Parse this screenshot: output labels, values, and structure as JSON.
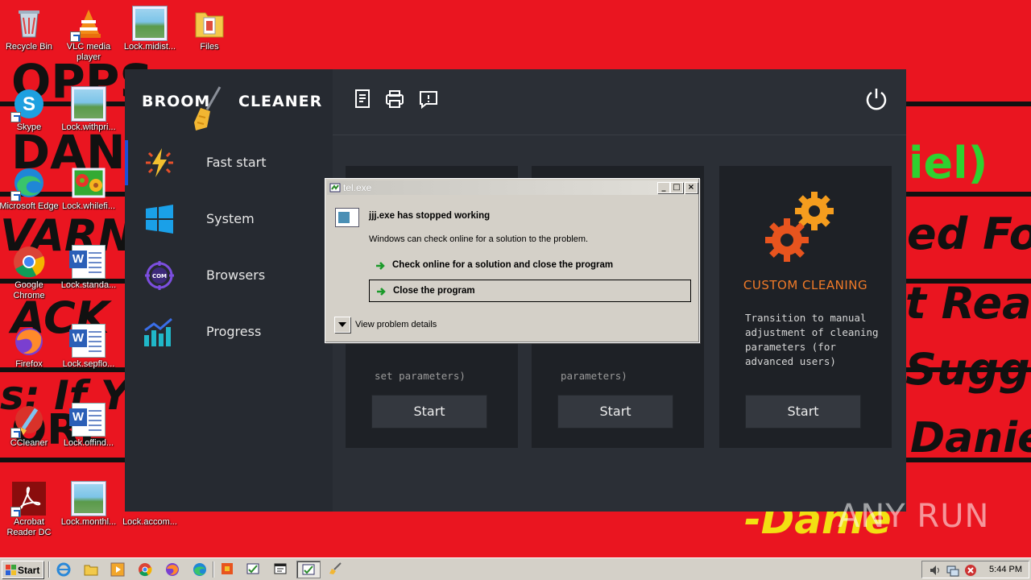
{
  "desktop": {
    "wallpaper": {
      "lines": [
        {
          "text": "OPPS",
          "style": "dark"
        },
        {
          "text": "DANI",
          "style": "dark"
        },
        {
          "text": "iel)",
          "style": "green"
        },
        {
          "text": "VARNI",
          "style": "dark"
        },
        {
          "text": "ed For",
          "style": "dark"
        },
        {
          "text": "ACK B",
          "style": "dark"
        },
        {
          "text": "t Real",
          "style": "dark"
        },
        {
          "text": "s: If Y",
          "style": "dark"
        },
        {
          "text": "Sugge",
          "style": "dark"
        },
        {
          "text": "ORE",
          "style": "dark"
        },
        {
          "text": "Daniel",
          "style": "dark"
        },
        {
          "text": "-Danie",
          "style": "yellow"
        }
      ]
    },
    "icons": [
      {
        "label": "Recycle Bin",
        "icon": "recycle-bin-icon"
      },
      {
        "label": "VLC media player",
        "icon": "vlc-icon"
      },
      {
        "label": "Lock.midist...",
        "icon": "image-file-icon"
      },
      {
        "label": "Files",
        "icon": "folder-icon"
      },
      {
        "label": "Skype",
        "icon": "skype-icon"
      },
      {
        "label": "Lock.withpri...",
        "icon": "image-file-icon"
      },
      {
        "label": "Microsoft Edge",
        "icon": "edge-icon"
      },
      {
        "label": "Lock.whilefi...",
        "icon": "image-file-icon"
      },
      {
        "label": "Google Chrome",
        "icon": "chrome-icon"
      },
      {
        "label": "Lock.standa...",
        "icon": "word-doc-icon"
      },
      {
        "label": "Firefox",
        "icon": "firefox-icon"
      },
      {
        "label": "Lock.sepflo...",
        "icon": "word-doc-icon"
      },
      {
        "label": "CCleaner",
        "icon": "ccleaner-icon"
      },
      {
        "label": "Lock.offind...",
        "icon": "word-doc-icon"
      },
      {
        "label": "Acrobat Reader DC",
        "icon": "acrobat-icon"
      },
      {
        "label": "Lock.monthl...",
        "icon": "image-file-icon"
      },
      {
        "label": "Lock.accom...",
        "icon": "image-file-icon"
      }
    ]
  },
  "app": {
    "logo_left": "BROOM",
    "logo_right": "CLEANER",
    "sidebar": [
      {
        "label": "Fast start",
        "icon": "lightning-icon",
        "active": true
      },
      {
        "label": "System",
        "icon": "windows-icon",
        "active": false
      },
      {
        "label": "Browsers",
        "icon": "browser-target-icon",
        "active": false
      },
      {
        "label": "Progress",
        "icon": "bar-chart-icon",
        "active": false
      }
    ],
    "topbar_icons": [
      "report-icon",
      "printer-icon",
      "feedback-icon",
      "power-icon"
    ],
    "cards": [
      {
        "title": "",
        "desc": "",
        "underlay": "set parameters)",
        "button": "Start"
      },
      {
        "title": "",
        "desc": "",
        "underlay": "parameters)",
        "button": "Start"
      },
      {
        "title": "CUSTOM CLEANING",
        "desc": "Transition to manual adjustment of cleaning parameters (for advanced users)",
        "underlay": "",
        "button": "Start"
      }
    ],
    "colors": {
      "accent": "#f07a28",
      "sidebar_active": "#1b4fd8",
      "background": "#2b2f36"
    }
  },
  "dialog": {
    "title": "tel.exe",
    "heading": "jjj.exe has stopped working",
    "subtext": "Windows can check online for a solution to the problem.",
    "options": [
      {
        "label": "Check online for a solution and close the program",
        "focused": false
      },
      {
        "label": "Close the program",
        "focused": true
      }
    ],
    "details_label": "View problem details",
    "buttons": {
      "minimize": "_",
      "maximize": "□",
      "close": "×"
    }
  },
  "taskbar": {
    "start_label": "Start",
    "quick_launch": [
      "ie-icon",
      "explorer-icon",
      "media-player-icon",
      "chrome-icon",
      "firefox-icon",
      "edge-icon"
    ],
    "tasks": [
      "app-task-icon",
      "check-task-icon",
      "window-task-icon",
      "check-task-icon-active",
      "broom-task-icon"
    ],
    "clock": "5:44 PM"
  },
  "watermark": {
    "text": "ANY RUN"
  }
}
